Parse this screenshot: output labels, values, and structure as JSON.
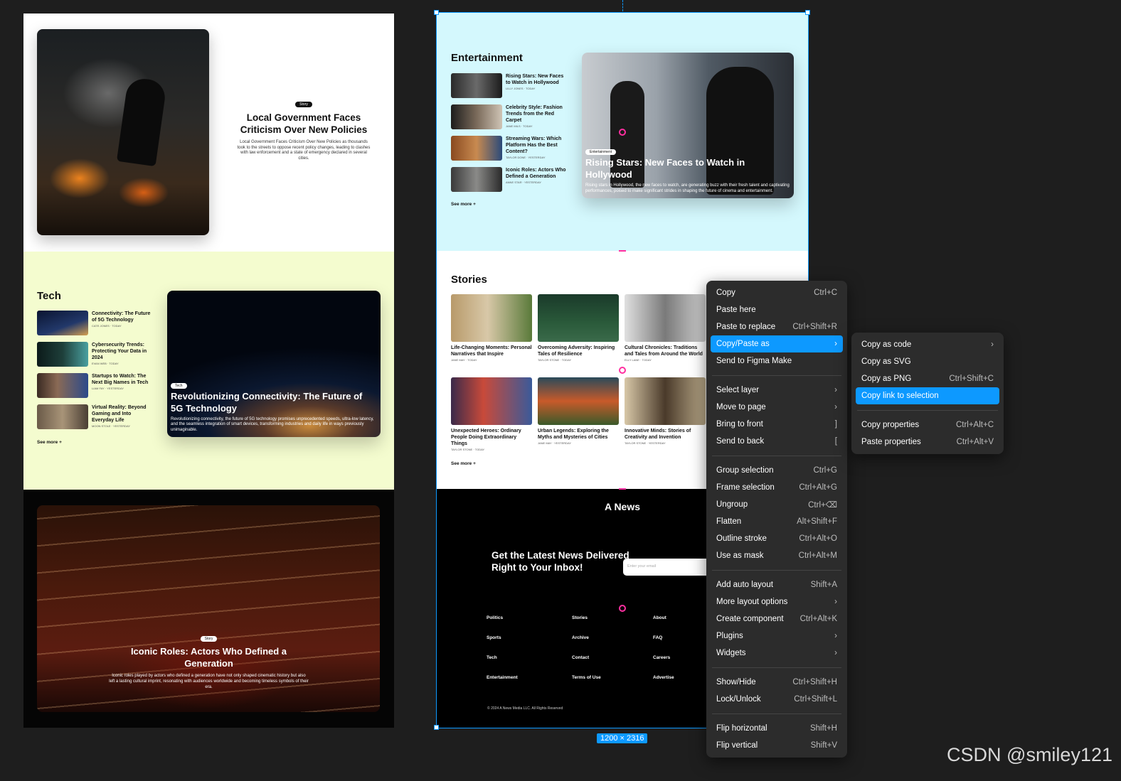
{
  "left_frame": {
    "hero": {
      "badge": "Story",
      "title": "Local Government Faces Criticism Over New Policies",
      "description": "Local Government Faces Criticism Over New Policies as thousands took to the streets to oppose recent policy changes, leading to clashes with law enforcement and a state of emergency declared in several cities."
    },
    "tech": {
      "heading": "Tech",
      "items": [
        {
          "title": "Connectivity: The Future of 5G Technology",
          "meta": "CATE JONES · TODAY"
        },
        {
          "title": "Cybersecurity Trends: Protecting Your Data in 2024",
          "meta": "EVAN WEB · TODAY"
        },
        {
          "title": "Startups to Watch: The Next Big Names in Tech",
          "meta": "LIAM FAY · YESTERDAY"
        },
        {
          "title": "Virtual Reality: Beyond Gaming and Into Everyday Life",
          "meta": "MOON STOLE · YESTERDAY"
        }
      ],
      "see_more": "See more +",
      "feature": {
        "badge": "Tech",
        "title": "Revolutionizing Connectivity: The Future of 5G Technology",
        "description": "Revolutionizing connectivity, the future of 5G technology promises unprecedented speeds, ultra-low latency, and the seamless integration of smart devices, transforming industries and daily life in ways previously unimaginable."
      }
    },
    "opera": {
      "badge": "Story",
      "title": "Iconic Roles: Actors Who Defined a Generation",
      "description": "Iconic roles played by actors who defined a generation have not only shaped cinematic history but also left a lasting cultural imprint, resonating with audiences worldwide and becoming timeless symbols of their era."
    }
  },
  "right_frame": {
    "entertainment": {
      "heading": "Entertainment",
      "items": [
        {
          "title": "Rising Stars: New Faces to Watch in Hollywood",
          "meta": "LILLY JONES · TODAY"
        },
        {
          "title": "Celebrity Style: Fashion Trends from the Red Carpet",
          "meta": "JANE MILS · TODAY"
        },
        {
          "title": "Streaming Wars: Which Platform Has the Best Content?",
          "meta": "TAYLOR DONE · YESTERDAY"
        },
        {
          "title": "Iconic Roles: Actors Who Defined a Generation",
          "meta": "ANNE STAR · YESTERDAY"
        }
      ],
      "see_more": "See more +",
      "feature": {
        "badge": "Entertainment",
        "title": "Rising Stars: New Faces to Watch in Hollywood",
        "description": "Rising stars in Hollywood, the new faces to watch, are generating buzz with their fresh talent and captivating performances, poised to make significant strides in shaping the future of cinema and entertainment."
      }
    },
    "stories": {
      "heading": "Stories",
      "cards": [
        {
          "title": "Life-Changing Moments: Personal Narratives that Inspire",
          "meta": "JANE MAY · TODAY"
        },
        {
          "title": "Overcoming Adversity: Inspiring Tales of Resilience",
          "meta": "TAYLOR STONE · TODAY"
        },
        {
          "title": "Cultural Chronicles: Traditions and Tales from Around the World",
          "meta": "ELLY LANE · TODAY"
        },
        {
          "title": "Unexpected Heroes: Ordinary People Doing Extraordinary Things",
          "meta": "TAYLOR STONE · TODAY"
        },
        {
          "title": "Urban Legends: Exploring the Myths and Mysteries of Cities",
          "meta": "JANE MAY · YESTERDAY"
        },
        {
          "title": "Innovative Minds: Stories of Creativity and Invention",
          "meta": "TAYLOR STONE · YESTERDAY"
        }
      ],
      "see_more": "See more +"
    },
    "footer": {
      "brand": "A News",
      "newsletter_title": "Get the Latest News Delivered Right to Your Inbox!",
      "email_placeholder": "Enter your email",
      "col1": [
        "Politics",
        "Sports",
        "Tech",
        "Entertainment"
      ],
      "col2": [
        "Stories",
        "Archive",
        "Contact",
        "Terms of Use"
      ],
      "col3": [
        "About",
        "FAQ",
        "Careers",
        "Advertise"
      ],
      "copyright": "© 2024 A News Media LLC. All Rights Reserved"
    }
  },
  "selection": {
    "size_label": "1200 × 2316",
    "accent_color": "#0d99ff",
    "pink_color": "#ff2fa0"
  },
  "context_menu": {
    "groups": [
      [
        {
          "label": "Copy",
          "shortcut": "Ctrl+C"
        },
        {
          "label": "Paste here",
          "shortcut": ""
        },
        {
          "label": "Paste to replace",
          "shortcut": "Ctrl+Shift+R"
        },
        {
          "label": "Copy/Paste as",
          "shortcut": "›",
          "active": true
        },
        {
          "label": "Send to Figma Make",
          "shortcut": ""
        }
      ],
      [
        {
          "label": "Select layer",
          "shortcut": "›"
        },
        {
          "label": "Move to page",
          "shortcut": "›"
        },
        {
          "label": "Bring to front",
          "shortcut": "]"
        },
        {
          "label": "Send to back",
          "shortcut": "["
        }
      ],
      [
        {
          "label": "Group selection",
          "shortcut": "Ctrl+G"
        },
        {
          "label": "Frame selection",
          "shortcut": "Ctrl+Alt+G"
        },
        {
          "label": "Ungroup",
          "shortcut": "Ctrl+⌫"
        },
        {
          "label": "Flatten",
          "shortcut": "Alt+Shift+F"
        },
        {
          "label": "Outline stroke",
          "shortcut": "Ctrl+Alt+O"
        },
        {
          "label": "Use as mask",
          "shortcut": "Ctrl+Alt+M"
        }
      ],
      [
        {
          "label": "Add auto layout",
          "shortcut": "Shift+A"
        },
        {
          "label": "More layout options",
          "shortcut": "›"
        },
        {
          "label": "Create component",
          "shortcut": "Ctrl+Alt+K"
        },
        {
          "label": "Plugins",
          "shortcut": "›"
        },
        {
          "label": "Widgets",
          "shortcut": "›"
        }
      ],
      [
        {
          "label": "Show/Hide",
          "shortcut": "Ctrl+Shift+H"
        },
        {
          "label": "Lock/Unlock",
          "shortcut": "Ctrl+Shift+L"
        }
      ],
      [
        {
          "label": "Flip horizontal",
          "shortcut": "Shift+H"
        },
        {
          "label": "Flip vertical",
          "shortcut": "Shift+V"
        }
      ]
    ]
  },
  "submenu": {
    "groups": [
      [
        {
          "label": "Copy as code",
          "shortcut": "›"
        },
        {
          "label": "Copy as SVG",
          "shortcut": ""
        },
        {
          "label": "Copy as PNG",
          "shortcut": "Ctrl+Shift+C"
        },
        {
          "label": "Copy link to selection",
          "shortcut": "",
          "active": true
        }
      ],
      [
        {
          "label": "Copy properties",
          "shortcut": "Ctrl+Alt+C"
        },
        {
          "label": "Paste properties",
          "shortcut": "Ctrl+Alt+V"
        }
      ]
    ]
  },
  "watermark": "CSDN @smiley121"
}
